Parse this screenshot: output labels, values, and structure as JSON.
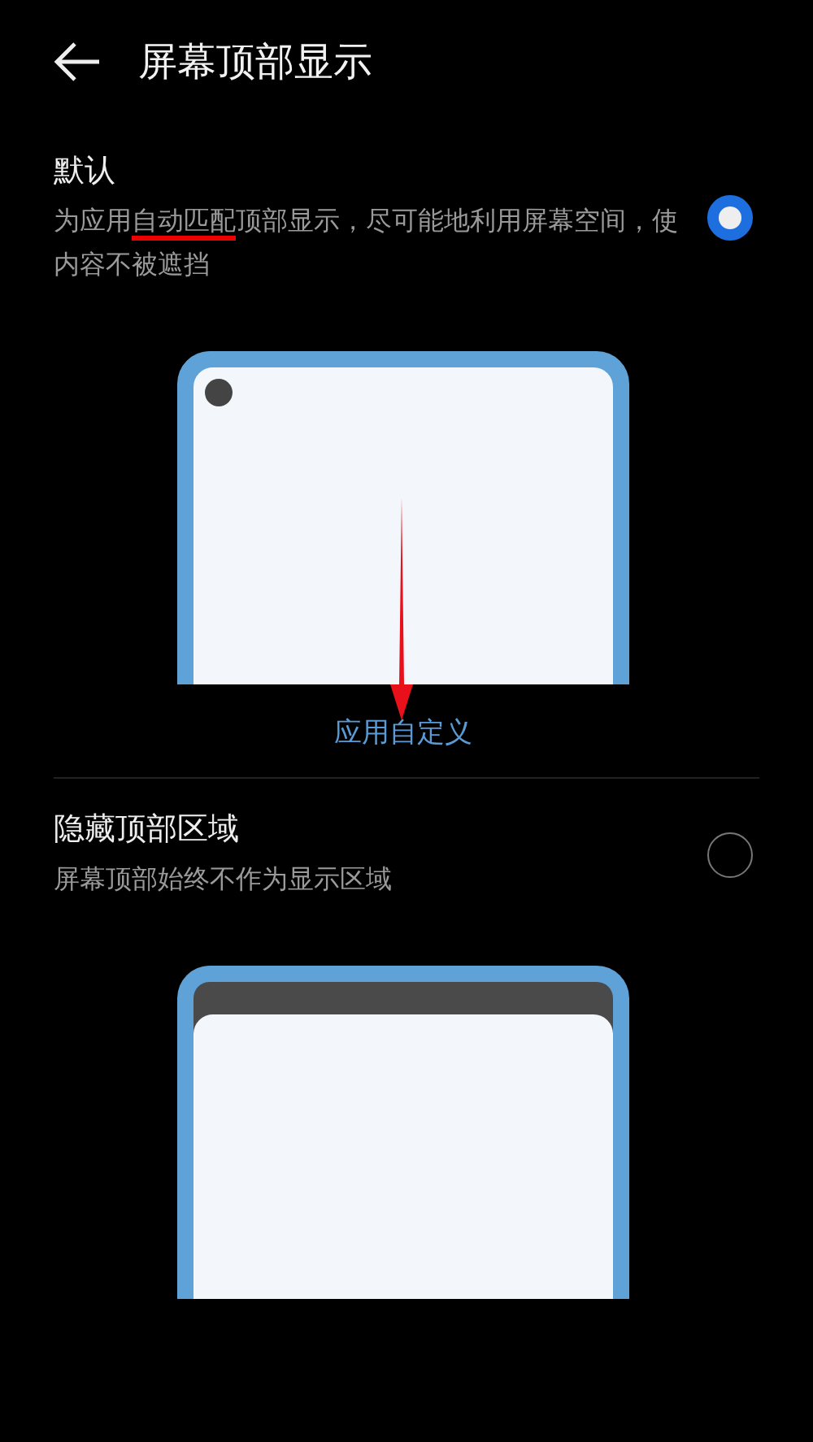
{
  "header": {
    "title": "屏幕顶部显示"
  },
  "options": [
    {
      "kind": "notch",
      "title": "默认",
      "description_parts": [
        {
          "text": "为应用",
          "underlined": false
        },
        {
          "text": "自动匹配",
          "underlined": true
        },
        {
          "text": "顶部显示，尽可能地利用屏幕空间，使内容不被遮挡",
          "underlined": false
        }
      ],
      "selected": true,
      "link": "应用自定义"
    },
    {
      "kind": "bar",
      "title": "隐藏顶部区域",
      "description_parts": [
        {
          "text": "屏幕顶部始终不作为显示区域",
          "underlined": false
        }
      ],
      "selected": false
    }
  ]
}
